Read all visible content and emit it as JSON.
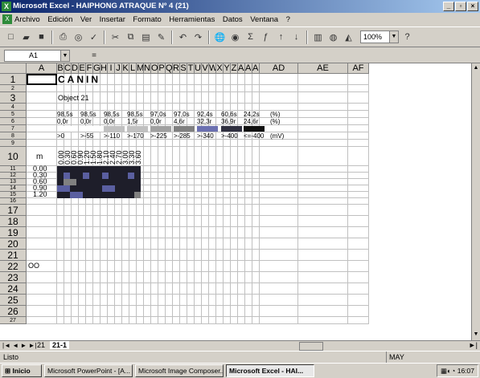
{
  "window": {
    "title": "Microsoft Excel - HAIPHONG ATRAQUE Nº 4 (21)",
    "app_icon": "excel-icon",
    "buttons": [
      "_",
      "▫",
      "×"
    ]
  },
  "menu": {
    "items": [
      "Archivo",
      "Edición",
      "Ver",
      "Insertar",
      "Formato",
      "Herramientas",
      "Datos",
      "Ventana",
      "?"
    ]
  },
  "toolbar": {
    "zoom": "100%"
  },
  "formula": {
    "name_box": "A1",
    "eq": "="
  },
  "columns": [
    "A",
    "B",
    "C",
    "D",
    "E",
    "F",
    "G",
    "H",
    "I",
    "J",
    "K",
    "L",
    "M",
    "N",
    "O",
    "P",
    "Q",
    "R",
    "S",
    "T",
    "U",
    "V",
    "W",
    "X",
    "Y",
    "Z",
    "AA",
    "AB",
    "AC",
    "AD",
    "AE",
    "AF"
  ],
  "rows": [
    "1",
    "2",
    "3",
    "4",
    "5",
    "6",
    "7",
    "8",
    "9",
    "10",
    "11",
    "12",
    "13",
    "14",
    "15",
    "16",
    "17",
    "18",
    "19",
    "20",
    "21",
    "22",
    "23",
    "24",
    "25",
    "26",
    "27"
  ],
  "sheet": {
    "title": "CANIN",
    "object": "Object 21",
    "pct": [
      "98,5s",
      "98,5s",
      "98,5s",
      "98,5s",
      "97,0s",
      "97,0s",
      "92,4s",
      "60,6s",
      "24,2s"
    ],
    "pct2": [
      "0,0r",
      "0,0r",
      "0,0r",
      "1,5r",
      "0,0r",
      "4,6r",
      "32,3r",
      "36,9r",
      "24,6r"
    ],
    "pct_unit": "(%)",
    "pct2_unit": "(%)",
    "mv": [
      ">0",
      ">-55",
      ">-110",
      ">-170",
      ">-225",
      ">-285",
      ">-340",
      ">-400",
      "<=-400"
    ],
    "mv_unit": "(mV)",
    "swatch_colors": [
      "#ffffff",
      "#ffffff",
      "#c0c0c0",
      "#c0c0c0",
      "#a0a0a0",
      "#808080",
      "#6b70b0",
      "#303040",
      "#101010"
    ],
    "m_label": "m",
    "depths": [
      "0.00",
      "0.30",
      "0.60",
      "0.90",
      "1.20"
    ],
    "heat_header": [
      "0.00",
      "0.30",
      "0.60",
      "0.90",
      "1.20",
      "1.50",
      "1.80",
      "2.10",
      "2.40",
      "2.70",
      "3.00",
      "3.30",
      "3.60"
    ],
    "row22": "OO"
  },
  "tabs": {
    "nav": "|◄ ◄ ► ►|",
    "items": [
      "21",
      "21-1"
    ]
  },
  "status": {
    "left": "Listo",
    "mode": "MAY"
  },
  "taskbar": {
    "start": "Inicio",
    "items": [
      "Microsoft PowerPoint - [A...",
      "Microsoft Image Composer...",
      "Microsoft Excel - HAI..."
    ],
    "clock": "16:07"
  },
  "colors": {
    "title_start": "#0a246a",
    "title_end": "#a6caf0",
    "heat_dark": "#1e1e2a",
    "heat_blue": "#5a5fa0",
    "heat_gray": "#808080"
  }
}
